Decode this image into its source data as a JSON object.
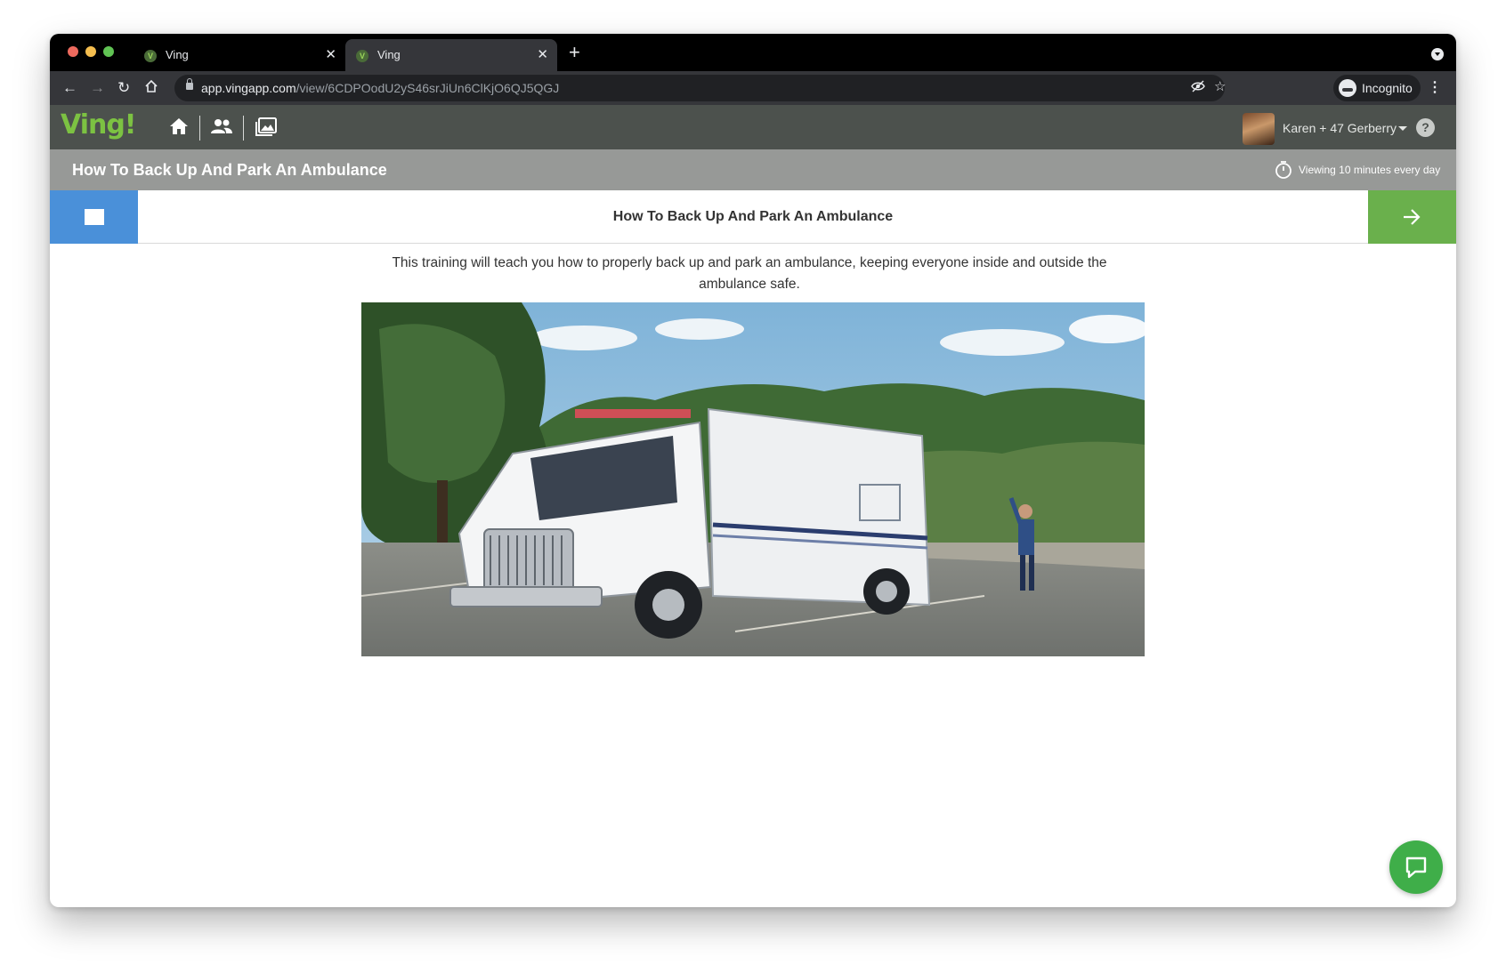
{
  "browser": {
    "tabs": [
      {
        "title": "Ving",
        "active": false
      },
      {
        "title": "Ving",
        "active": true
      }
    ],
    "url_host": "app.vingapp.com",
    "url_path": "/view/6CDPOodU2yS46srJiUn6ClKjO6QJ5QGJ",
    "profile_label": "Incognito"
  },
  "app": {
    "logo": "Ving!",
    "user_name": "Karen + 47 Gerberry",
    "help_label": "?"
  },
  "page": {
    "title": "How To Back Up And Park An Ambulance",
    "viewing_label": "Viewing 10 minutes every day",
    "lesson_title": "How To Back Up And Park An Ambulance",
    "description": "This training will teach you how to properly back up and park an ambulance, keeping everyone inside and outside the ambulance safe."
  },
  "colors": {
    "app_header": "#4c514d",
    "title_bar": "#979997",
    "grid_button": "#4a90d9",
    "next_button": "#6ab04c",
    "chat_button": "#3fae49",
    "logo_green": "#7cc242"
  },
  "icons": {
    "nav": [
      "home-icon",
      "people-icon",
      "gallery-icon"
    ],
    "content": [
      "grid-icon",
      "arrow-right-icon",
      "timer-icon",
      "chat-icon"
    ]
  }
}
